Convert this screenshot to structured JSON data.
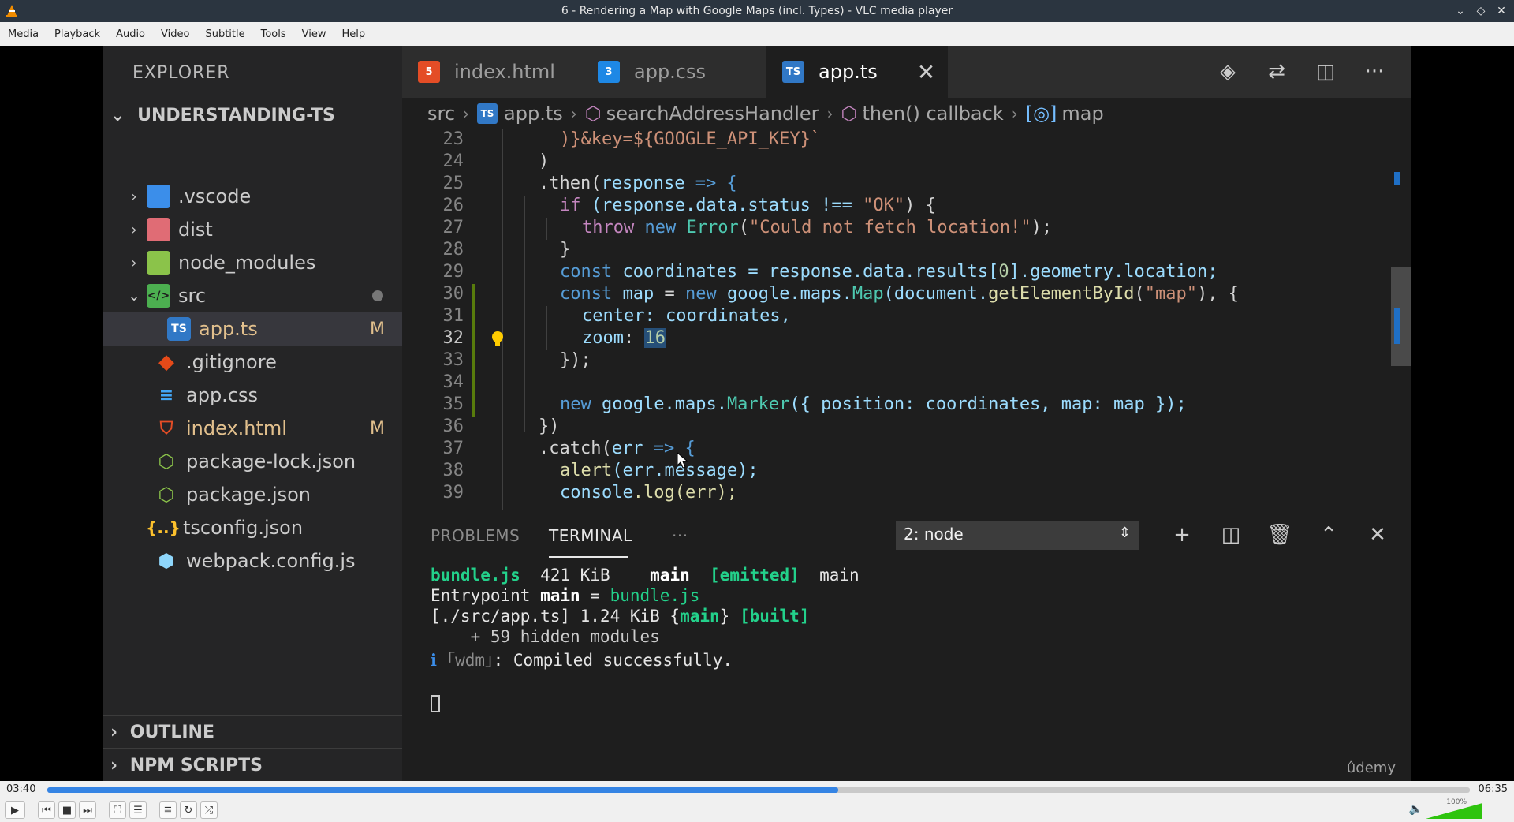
{
  "window": {
    "title": "6 - Rendering a Map with Google Maps (incl. Types) - VLC media player"
  },
  "menu": [
    "Media",
    "Playback",
    "Audio",
    "Video",
    "Subtitle",
    "Tools",
    "View",
    "Help"
  ],
  "explorer": {
    "header": "EXPLORER",
    "project": "UNDERSTANDING-TS",
    "items": [
      {
        "label": ".vscode",
        "badge": ""
      },
      {
        "label": "dist",
        "badge": ""
      },
      {
        "label": "node_modules",
        "badge": ""
      },
      {
        "label": "src",
        "badge": ""
      },
      {
        "label": "app.ts",
        "badge": "M"
      },
      {
        "label": ".gitignore",
        "badge": ""
      },
      {
        "label": "app.css",
        "badge": ""
      },
      {
        "label": "index.html",
        "badge": "M"
      },
      {
        "label": "package-lock.json",
        "badge": ""
      },
      {
        "label": "package.json",
        "badge": ""
      },
      {
        "label": "tsconfig.json",
        "badge": ""
      },
      {
        "label": "webpack.config.js",
        "badge": ""
      }
    ],
    "sections": [
      "OUTLINE",
      "NPM SCRIPTS"
    ]
  },
  "tabs": [
    {
      "label": "index.html",
      "icon": "5"
    },
    {
      "label": "app.css",
      "icon": "3"
    },
    {
      "label": "app.ts",
      "icon": "TS"
    }
  ],
  "breadcrumb": {
    "parts": [
      "src",
      "app.ts",
      "searchAddressHandler",
      "then() callback",
      "map"
    ],
    "ts_icon": "TS"
  },
  "editor": {
    "line_numbers": [
      "23",
      "24",
      "25",
      "26",
      "27",
      "28",
      "29",
      "30",
      "31",
      "32",
      "33",
      "34",
      "35",
      "36",
      "37",
      "38",
      "39"
    ],
    "code": {
      "l23a": ")}&key=${GOOGLE_API_KEY}`",
      "l24": ")",
      "l25a": ".then(",
      "l25b": "response",
      "l25c": " => {",
      "l26a": "if",
      "l26b": " (response.data.status !== ",
      "l26c": "\"OK\"",
      "l26d": ") {",
      "l27a": "throw",
      "l27b": " new ",
      "l27c": "Error",
      "l27d": "(",
      "l27e": "\"Could not fetch location!\"",
      "l27f": ");",
      "l28": "}",
      "l29a": "const",
      "l29b": " coordinates",
      "l29c": " = response.data.results[",
      "l29d": "0",
      "l29e": "].geometry.location;",
      "l30a": "const",
      "l30b": " map",
      "l30c": " = ",
      "l30d": "new",
      "l30e": " google.maps.",
      "l30f": "Map",
      "l30g": "(document.",
      "l30h": "getElementById",
      "l30i": "(",
      "l30j": "\"map\"",
      "l30k": "), {",
      "l31a": "center",
      "l31b": ": coordinates,",
      "l32a": "zoom",
      "l32b": ": ",
      "l32c": "16",
      "l33": "});",
      "l35a": "new",
      "l35b": " google.maps.",
      "l35c": "Marker",
      "l35d": "({ position: coordinates, map: map });",
      "l36": "})",
      "l37a": ".catch(",
      "l37b": "err",
      "l37c": " => {",
      "l38a": "alert",
      "l38b": "(err.message);",
      "l39a": "console",
      "l39b": ".log(err);"
    }
  },
  "panel": {
    "tabs": [
      "PROBLEMS",
      "TERMINAL",
      "···"
    ],
    "terminal_select": "2: node",
    "lines": {
      "t1a": "bundle.js",
      "t1b": "  421 KiB",
      "t1c": "    main",
      "t1d": "  [emitted]",
      "t1e": "  main",
      "t2a": "Entrypoint ",
      "t2b": "main",
      "t2c": " = ",
      "t2d": "bundle.js",
      "t3a": "[./src/app.ts] 1.24 KiB {",
      "t3b": "main",
      "t3c": "} ",
      "t3d": "[built]",
      "t4": "    + 59 hidden modules",
      "t5a": "ℹ ",
      "t5b": "｢wdm｣",
      "t5c": ": Compiled successfully."
    },
    "watermark": "ûdemy"
  },
  "player": {
    "elapsed": "03:40",
    "total": "06:35",
    "progress": 0.556,
    "volume_label": "100%",
    "volume": 1.0
  }
}
